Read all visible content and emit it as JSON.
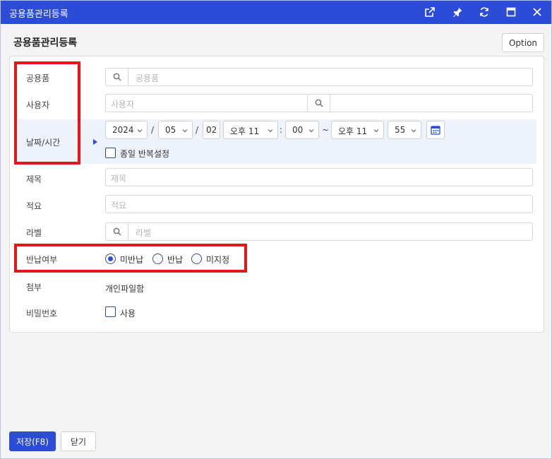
{
  "window": {
    "title": "공용품관리등록"
  },
  "header": {
    "title": "공용품관리등록",
    "option_label": "Option"
  },
  "form": {
    "item": {
      "label": "공용품",
      "placeholder": "공용품"
    },
    "user": {
      "label": "사용자",
      "placeholder": "사용자"
    },
    "datetime": {
      "label": "날짜/시간",
      "year": "2024",
      "month": "05",
      "day": "02",
      "start_ampm_hour": "오후 11",
      "start_minute": "00",
      "end_ampm_hour": "오후 11",
      "end_minute": "55",
      "date_sep": "/",
      "time_sep": ":",
      "range_sep": "~",
      "allday_label": "종일 반복설정"
    },
    "subject": {
      "label": "제목",
      "placeholder": "제목"
    },
    "summary": {
      "label": "적요",
      "placeholder": "적요"
    },
    "tag": {
      "label": "라벨",
      "placeholder": "라벨"
    },
    "return": {
      "label": "반납여부",
      "options": [
        "미반납",
        "반납",
        "미지정"
      ],
      "selected": "미반납"
    },
    "attach": {
      "label": "첨부",
      "value": "개인파일함"
    },
    "password": {
      "label": "비밀번호",
      "checkbox_label": "사용"
    }
  },
  "footer": {
    "save_label": "저장(F8)",
    "close_label": "닫기"
  },
  "colors": {
    "titlebar": "#2c4bd6",
    "highlight": "#e8141c",
    "date_row_bg": "#eef2fb"
  }
}
